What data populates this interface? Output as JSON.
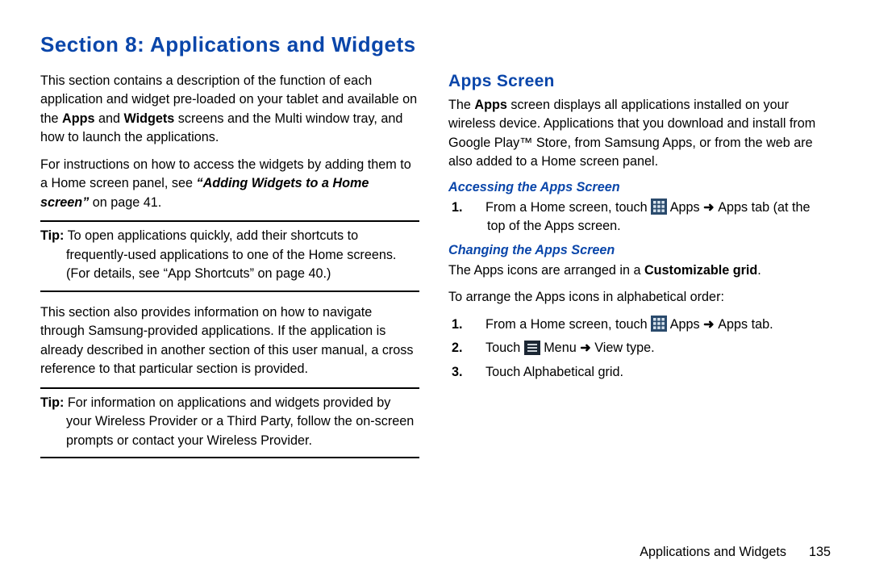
{
  "page": {
    "section_title": "Section 8: Applications and Widgets",
    "footer_text": "Applications and Widgets",
    "page_number": "135"
  },
  "left": {
    "para1_a": "This section contains a description of the function of each application and widget pre-loaded on your tablet and available on the ",
    "para1_bold1": "Apps",
    "para1_b": " and ",
    "para1_bold2": "Widgets",
    "para1_c": " screens and the Multi window tray, and how to launch the applications.",
    "para2_a": "For instructions on how to access the widgets by adding them to a Home screen panel, see ",
    "para2_ref": "“Adding Widgets to a Home screen”",
    "para2_b": " on page 41.",
    "tip1_label": "Tip:",
    "tip1_body_a": " To open applications quickly, add their shortcuts to frequently-used applications to one of the Home screens. (For details, see ",
    "tip1_ref": "“App Shortcuts”",
    "tip1_body_b": " on page 40.)",
    "para3": "This section also provides information on how to navigate through Samsung-provided applications. If the application is already described in another section of this user manual, a cross reference to that particular section is provided.",
    "tip2_label": "Tip:",
    "tip2_body": " For information on applications and widgets provided by your Wireless Provider or a Third Party, follow the on-screen prompts or contact your Wireless Provider."
  },
  "right": {
    "h2": "Apps Screen",
    "para1_a": "The ",
    "para1_bold": "Apps",
    "para1_b": " screen displays all applications installed on your wireless device. Applications that you download and install from Google Play™ Store, from Samsung Apps, or from the web are also added to a Home screen panel.",
    "sub1": "Accessing the Apps Screen",
    "step1_num": "1.",
    "step1_a": "From a Home screen, touch ",
    "step1_bold1": "Apps",
    "step1_arrow": " ➜ ",
    "step1_bold2": "Apps",
    "step1_b": " tab (at the top of the ",
    "step1_bold3": "Apps",
    "step1_c": " screen.",
    "sub2": "Changing the Apps Screen",
    "para2_a": "The Apps icons are arranged in a ",
    "para2_bold": "Customizable grid",
    "para2_b": ".",
    "para3": "To arrange the Apps icons in alphabetical order:",
    "c_step1_num": "1.",
    "c_step1_a": "From a Home screen, touch ",
    "c_step1_bold1": "Apps",
    "c_step1_arrow": " ➜ ",
    "c_step1_bold2": "Apps",
    "c_step1_b": " tab.",
    "c_step2_num": "2.",
    "c_step2_a": "Touch ",
    "c_step2_bold1": "Menu",
    "c_step2_arrow": " ➜ ",
    "c_step2_bold2": "View type",
    "c_step2_b": ".",
    "c_step3_num": "3.",
    "c_step3_a": "Touch ",
    "c_step3_bold": "Alphabetical grid",
    "c_step3_b": "."
  }
}
